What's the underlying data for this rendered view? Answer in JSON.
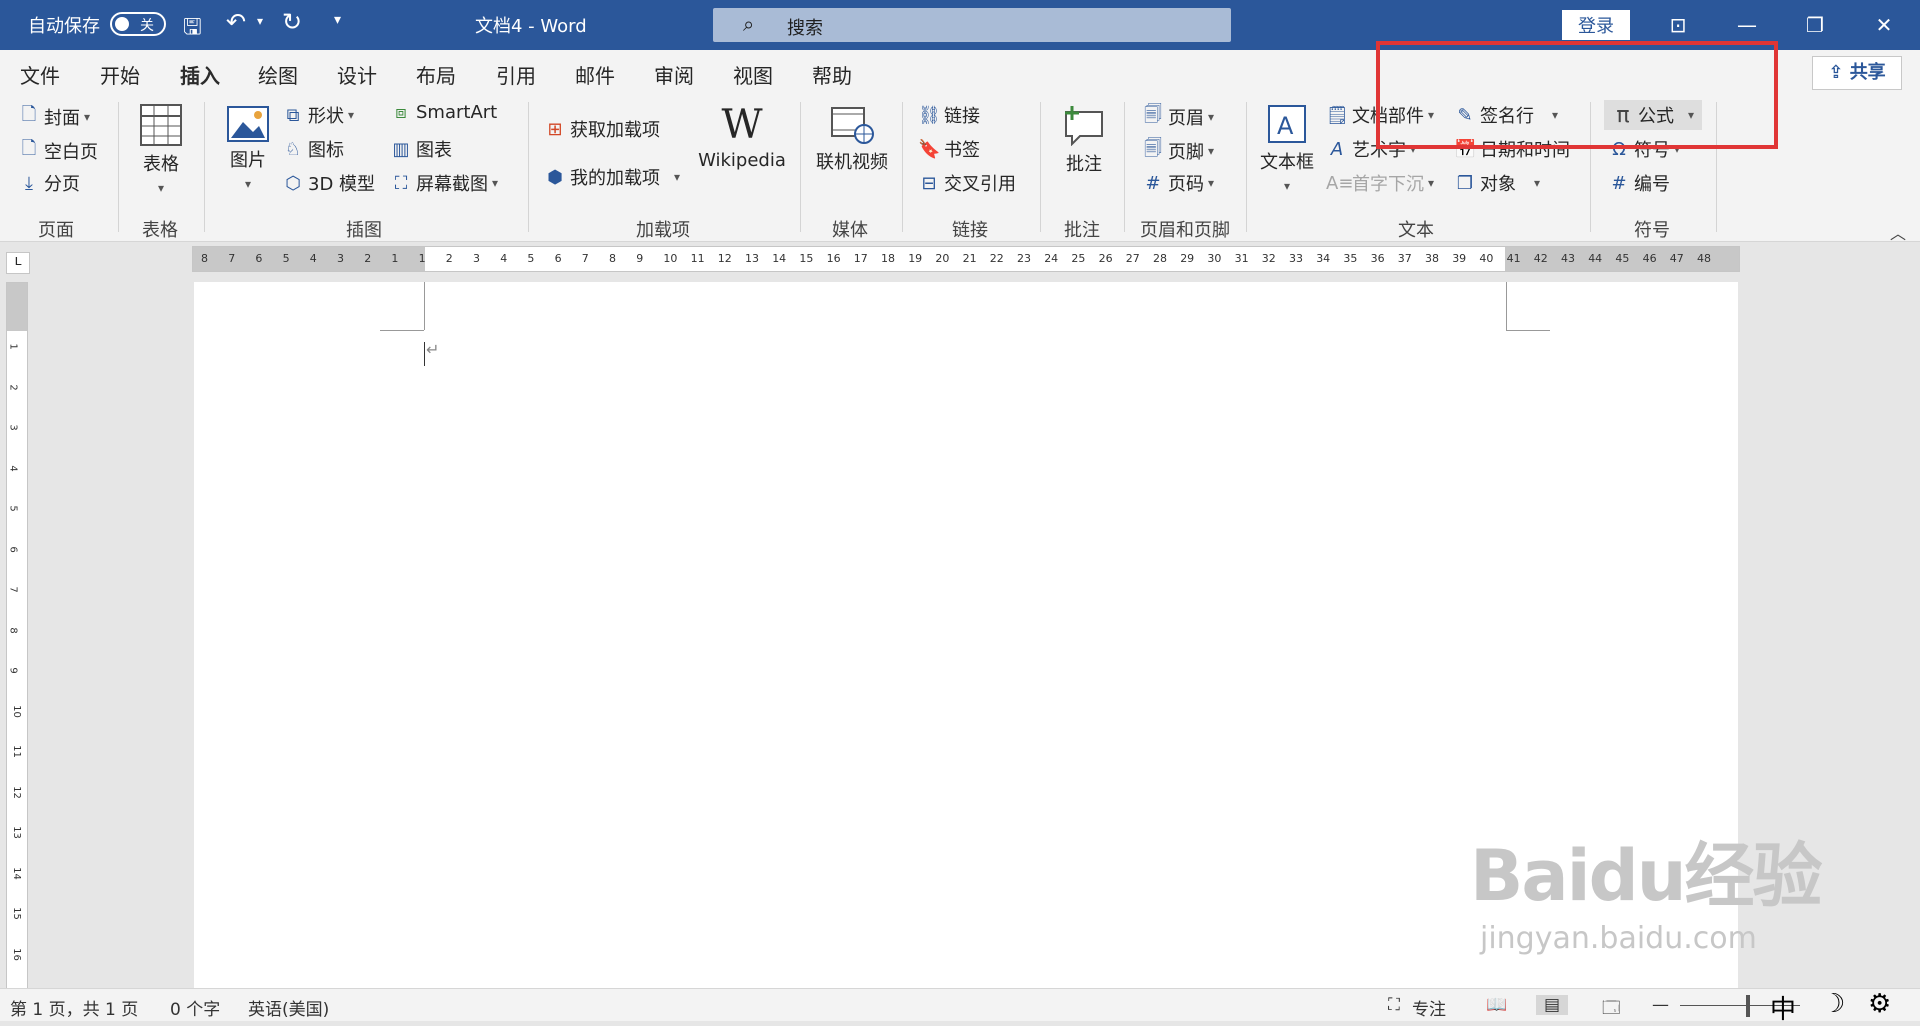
{
  "titlebar": {
    "autosave_label": "自动保存",
    "autosave_state": "关",
    "doc_title": "文档4  -  Word",
    "search_placeholder": "搜索",
    "login_label": "登录"
  },
  "tabs": [
    "文件",
    "开始",
    "插入",
    "绘图",
    "设计",
    "布局",
    "引用",
    "邮件",
    "审阅",
    "视图",
    "帮助"
  ],
  "active_tab": "插入",
  "share_label": "共享",
  "ribbon": {
    "page": {
      "cover": "封面",
      "blank": "空白页",
      "break": "分页",
      "group": "页面"
    },
    "table": {
      "table": "表格",
      "group": "表格"
    },
    "illustrations": {
      "pictures": "图片",
      "shapes": "形状",
      "icons": "图标",
      "model3d": "3D 模型",
      "smartart": "SmartArt",
      "chart": "图表",
      "screenshot": "屏幕截图",
      "group": "插图"
    },
    "addins": {
      "get": "获取加载项",
      "my": "我的加载项",
      "wikipedia": "Wikipedia",
      "group": "加载项"
    },
    "media": {
      "video": "联机视频",
      "group": "媒体"
    },
    "links": {
      "link": "链接",
      "bookmark": "书签",
      "crossref": "交叉引用",
      "group": "链接"
    },
    "comments": {
      "comment": "批注",
      "group": "批注"
    },
    "headerfooter": {
      "header": "页眉",
      "footer": "页脚",
      "pagenum": "页码",
      "group": "页眉和页脚"
    },
    "text": {
      "textbox": "文本框",
      "quickparts": "文档部件",
      "wordart": "艺术字",
      "dropcap": "首字下沉",
      "signature": "签名行",
      "datetime": "日期和时间",
      "object": "对象",
      "group": "文本"
    },
    "symbols": {
      "equation": "公式",
      "symbol": "符号",
      "numbering": "编号",
      "group": "符号"
    }
  },
  "ruler_numbers": [
    "8",
    "7",
    "6",
    "5",
    "4",
    "3",
    "2",
    "1",
    "1",
    "2",
    "3",
    "4",
    "5",
    "6",
    "7",
    "8",
    "9",
    "10",
    "11",
    "12",
    "13",
    "14",
    "15",
    "16",
    "17",
    "18",
    "19",
    "20",
    "21",
    "22",
    "23",
    "24",
    "25",
    "26",
    "27",
    "28",
    "29",
    "30",
    "31",
    "32",
    "33",
    "34",
    "35",
    "36",
    "37",
    "38",
    "39",
    "40",
    "41",
    "42",
    "43",
    "44",
    "45",
    "46",
    "47",
    "48"
  ],
  "vruler_numbers": [
    "1",
    "2",
    "3",
    "4",
    "5",
    "6",
    "7",
    "8",
    "9",
    "10",
    "11",
    "12",
    "13",
    "14",
    "15",
    "16"
  ],
  "status": {
    "page": "第 1 页，共 1 页",
    "words": "0 个字",
    "language": "英语(美国)",
    "focus": "专注",
    "ime": "中"
  },
  "watermark": {
    "brand": "Baidu经验",
    "url": "jingyan.baidu.com"
  },
  "colors": {
    "titlebar": "#2b579a",
    "highlight_box": "#e03535"
  }
}
